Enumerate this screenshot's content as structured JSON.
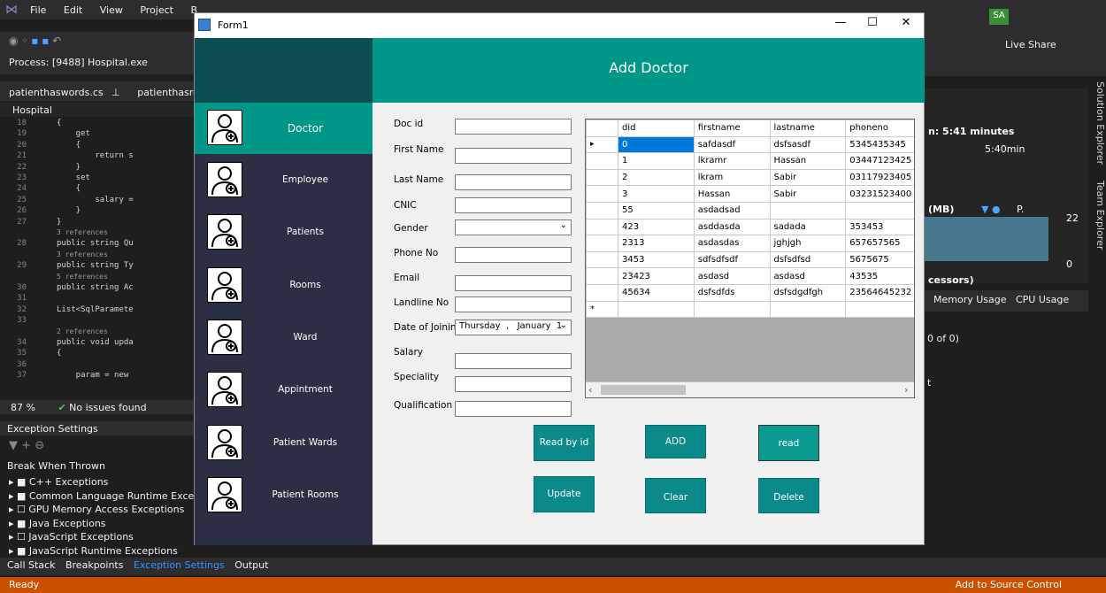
{
  "vs": {
    "menu": [
      "File",
      "Edit",
      "View",
      "Project",
      "B"
    ],
    "process_label": "Process: [9488] Hospital.exe",
    "tabs": [
      "patienthaswords.cs",
      "patienthasroc"
    ],
    "breadcrumb": "Hospital",
    "code_lines": [
      {
        "n": "18",
        "t": "{"
      },
      {
        "n": "19",
        "t": "    get"
      },
      {
        "n": "20",
        "t": "    {"
      },
      {
        "n": "21",
        "t": "        return s"
      },
      {
        "n": "22",
        "t": "    }"
      },
      {
        "n": "23",
        "t": "    set"
      },
      {
        "n": "24",
        "t": "    {"
      },
      {
        "n": "25",
        "t": "        salary ="
      },
      {
        "n": "26",
        "t": "    }"
      },
      {
        "n": "27",
        "t": "}"
      },
      {
        "n": "",
        "t": "3 references"
      },
      {
        "n": "28",
        "t": "public string Qu"
      },
      {
        "n": "",
        "t": "3 references"
      },
      {
        "n": "29",
        "t": "public string Ty"
      },
      {
        "n": "",
        "t": "5 references"
      },
      {
        "n": "30",
        "t": "public string Ac"
      },
      {
        "n": "31",
        "t": ""
      },
      {
        "n": "32",
        "t": "List<SqlParamete"
      },
      {
        "n": "33",
        "t": ""
      },
      {
        "n": "",
        "t": "2 references"
      },
      {
        "n": "34",
        "t": "public void upda"
      },
      {
        "n": "35",
        "t": "{"
      },
      {
        "n": "36",
        "t": ""
      },
      {
        "n": "37",
        "t": "    param = new"
      }
    ],
    "zoom": "87 %",
    "issues": "No issues found",
    "exception_settings_title": "Exception Settings",
    "break_when_thrown": "Break When Thrown",
    "exceptions": [
      "C++ Exceptions",
      "Common Language Runtime Excep",
      "GPU Memory Access Exceptions",
      "Java Exceptions",
      "JavaScript Exceptions",
      "JavaScript Runtime Exceptions"
    ],
    "bottom_tabs": [
      "Call Stack",
      "Breakpoints",
      "Exception Settings",
      "Output"
    ],
    "status_left": "Ready",
    "status_right": "Add to Source Control",
    "user_initials": "SA",
    "live_share": "Live Share",
    "side_tabs": [
      "Solution Explorer",
      "Team Explorer"
    ],
    "diag": {
      "session": "n: 5:41 minutes",
      "time_mark": "5:40min",
      "mem_label": "(MB)",
      "legend": "P.",
      "val_22": "22",
      "val_0": "0",
      "processors": "cessors)",
      "tabs": "Memory Usage   CPU Usage",
      "count": "0 of 0)",
      "t": "t"
    }
  },
  "form": {
    "title": "Form1",
    "header": "Add Doctor",
    "menu": [
      "Doctor",
      "Employee",
      "Patients",
      "Rooms",
      "Ward",
      "Appintment",
      "Patient Wards",
      "Patient Rooms"
    ],
    "fields": [
      {
        "label": "Doc id",
        "value": ""
      },
      {
        "label": "First Name",
        "value": ""
      },
      {
        "label": "Last Name",
        "value": ""
      },
      {
        "label": "CNIC",
        "value": ""
      },
      {
        "label": "Gender",
        "value": ""
      },
      {
        "label": "Phone No",
        "value": ""
      },
      {
        "label": "Email",
        "value": ""
      },
      {
        "label": "Landline No",
        "value": ""
      },
      {
        "label": "Date of Joining",
        "value": "Thursday  ,   January  1"
      },
      {
        "label": "Salary",
        "value": ""
      },
      {
        "label": "Speciality",
        "value": ""
      },
      {
        "label": "Qualification",
        "value": ""
      }
    ],
    "grid": {
      "columns": [
        "did",
        "firstname",
        "lastname",
        "phoneno"
      ],
      "rows": [
        [
          "0",
          "safdasdf",
          "dsfsasdf",
          "5345435345"
        ],
        [
          "1",
          "lkramr",
          "Hassan",
          "03447123425"
        ],
        [
          "2",
          "lkram",
          "Sabir",
          "03117923405"
        ],
        [
          "3",
          "Hassan",
          "Sabir",
          "03231523400"
        ],
        [
          "55",
          "asdadsad",
          "",
          ""
        ],
        [
          "423",
          "asddasda",
          "sadada",
          "353453"
        ],
        [
          "2313",
          "asdasdas",
          "jghjgh",
          "657657565"
        ],
        [
          "3453",
          "sdfsdfsdf",
          "dsfsdfsd",
          "5675675"
        ],
        [
          "23423",
          "asdasd",
          "asdasd",
          "43535"
        ],
        [
          "45634",
          "dsfsdfds",
          "dsfsdgdfgh",
          "23564645232"
        ]
      ],
      "new_row_marker": "*"
    },
    "buttons": {
      "read_by_id": "Read by id",
      "add": "ADD",
      "read": "read",
      "update": "Update",
      "clear": "Clear",
      "delete": "Delete"
    }
  }
}
